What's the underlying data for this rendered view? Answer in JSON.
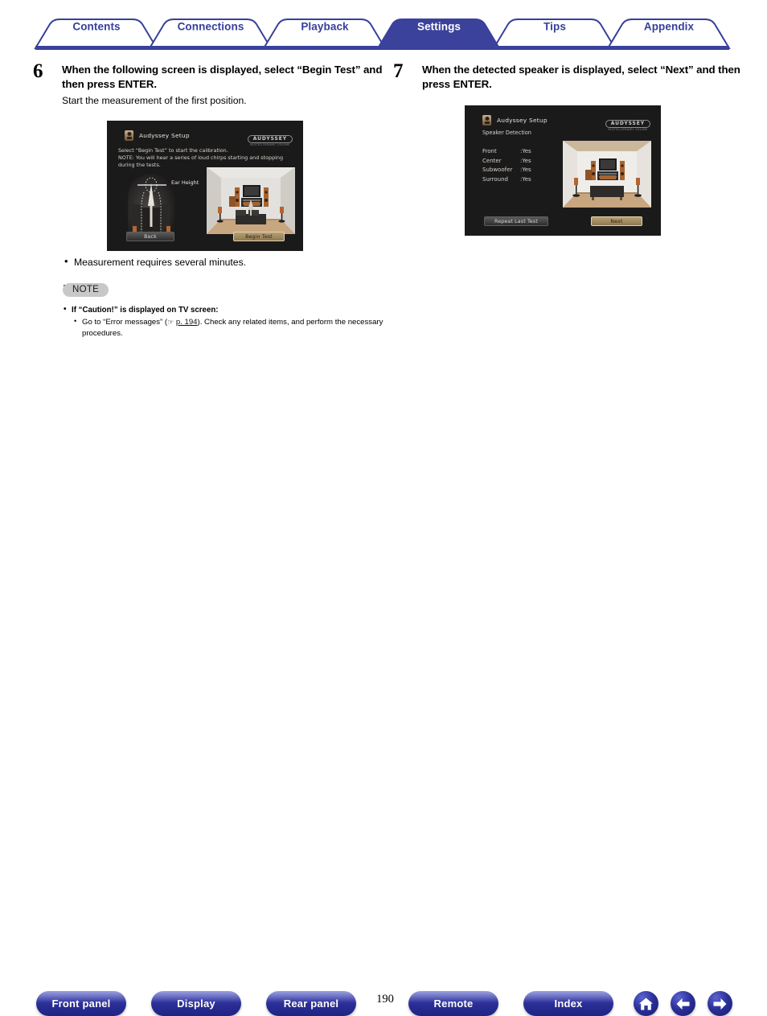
{
  "nav": {
    "tabs": [
      {
        "label": "Contents",
        "active": false
      },
      {
        "label": "Connections",
        "active": false
      },
      {
        "label": "Playback",
        "active": false
      },
      {
        "label": "Settings",
        "active": true
      },
      {
        "label": "Tips",
        "active": false
      },
      {
        "label": "Appendix",
        "active": false
      }
    ],
    "accent_color": "#36409a",
    "active_fill": "#3a429b"
  },
  "left_column": {
    "step_number": "6",
    "title": "When the following screen is displayed, select “Begin Test” and then press ENTER.",
    "subtitle": "Start the measurement of the first position.",
    "osd": {
      "app_title": "Audyssey Setup",
      "logo_main": "AUDYSSEY",
      "logo_sub": "MULTEQ\nDYNAMIC VOLUME",
      "body_text": "Select “Begin Test” to start the calibration.\nNOTE: You will hear a series of loud chirps starting and stopping\nduring the tests.",
      "ear_height_label": "Ear Height",
      "button_back": "Back",
      "button_begin": "Begin Test"
    },
    "bullet": "Measurement requires several minutes.",
    "note": {
      "badge": "NOTE",
      "line1": "If “Caution!” is displayed on TV screen:",
      "line2_pre": "Go to “Error messages” (",
      "line2_link": "p. 194",
      "line2_post": "). Check any related items, and perform the necessary procedures."
    }
  },
  "right_column": {
    "step_number": "7",
    "title": "When the detected speaker is displayed, select “Next” and then press ENTER.",
    "osd": {
      "app_title": "Audyssey Setup",
      "logo_main": "AUDYSSEY",
      "logo_sub": "MULTEQ\nDYNAMIC VOLUME",
      "section_label": "Speaker Detection",
      "detection": [
        {
          "name": "Front",
          "value": ":Yes"
        },
        {
          "name": "Center",
          "value": ":Yes"
        },
        {
          "name": "Subwoofer",
          "value": ":Yes"
        },
        {
          "name": "Surround",
          "value": ":Yes"
        }
      ],
      "button_repeat": "Repeat Last Test",
      "button_next": "Next"
    }
  },
  "footer": {
    "buttons": [
      {
        "label": "Front panel"
      },
      {
        "label": "Display"
      },
      {
        "label": "Rear panel"
      },
      {
        "label": "Remote"
      },
      {
        "label": "Index"
      }
    ],
    "page_number": "190",
    "nav_icons": [
      {
        "name": "home-icon"
      },
      {
        "name": "previous-page-icon"
      },
      {
        "name": "next-page-icon"
      }
    ]
  }
}
